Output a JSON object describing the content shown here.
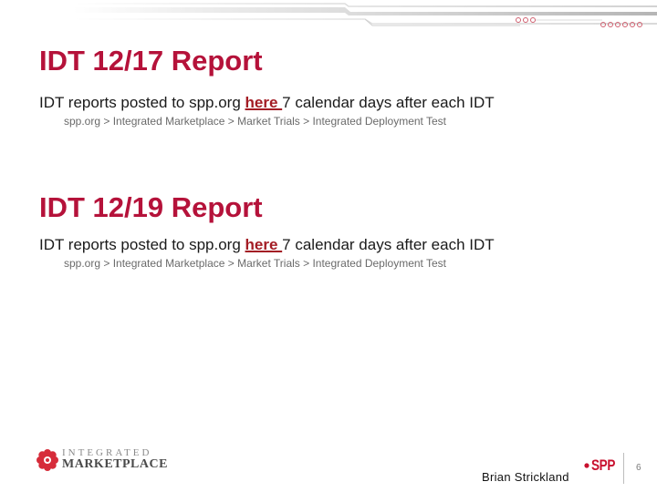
{
  "sections": [
    {
      "title": "IDT 12/17 Report",
      "body": {
        "prefix": "IDT reports posted to spp.org ",
        "link": "here ",
        "suffix": "7 calendar days after each IDT"
      },
      "breadcrumb": "spp.org > Integrated Marketplace > Market Trials >  Integrated Deployment Test"
    },
    {
      "title": "IDT 12/19 Report",
      "body": {
        "prefix": "IDT reports posted to spp.org ",
        "link": "here ",
        "suffix": "7 calendar days after each IDT"
      },
      "breadcrumb": "spp.org > Integrated Marketplace > Market Trials >  Integrated Deployment Test"
    }
  ],
  "footer": {
    "logo_top": "INTEGRATED",
    "logo_bottom": "MARKETPLACE",
    "presenter": "Brian Strickland",
    "spp_logo": "SPP",
    "page_number": "6"
  },
  "colors": {
    "title": "#b5123a",
    "link": "#a31c24",
    "accent": "#c8102e"
  }
}
